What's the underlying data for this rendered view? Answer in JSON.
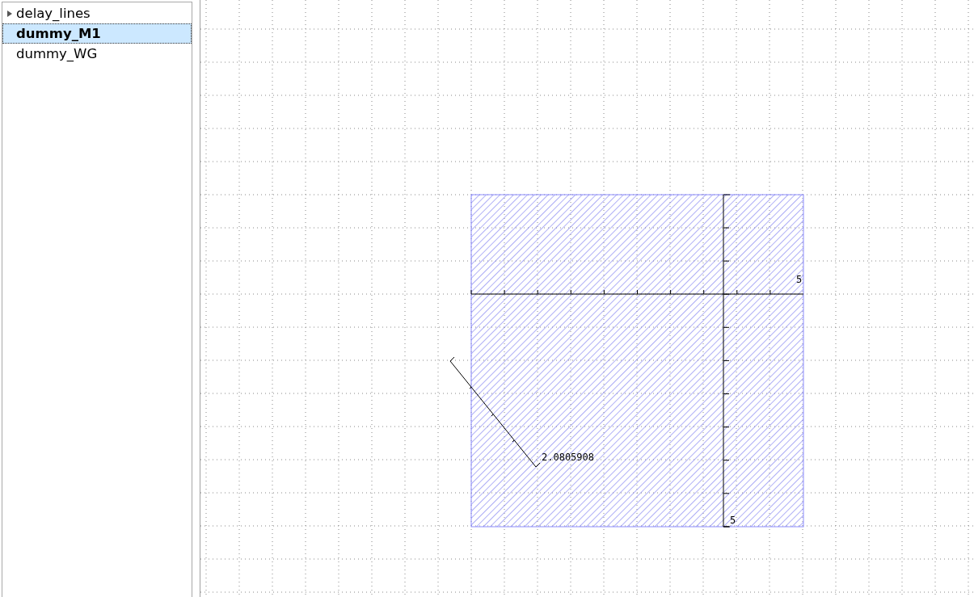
{
  "cell_tree": {
    "items": [
      {
        "label": "delay_lines",
        "expanded": false,
        "selected": false
      },
      {
        "label": "dummy_M1",
        "selected": true
      },
      {
        "label": "dummy_WG",
        "selected": false
      }
    ]
  },
  "canvas": {
    "axis_labels": [
      "5",
      "5"
    ],
    "ruler": {
      "reading": "2.0805908"
    }
  }
}
